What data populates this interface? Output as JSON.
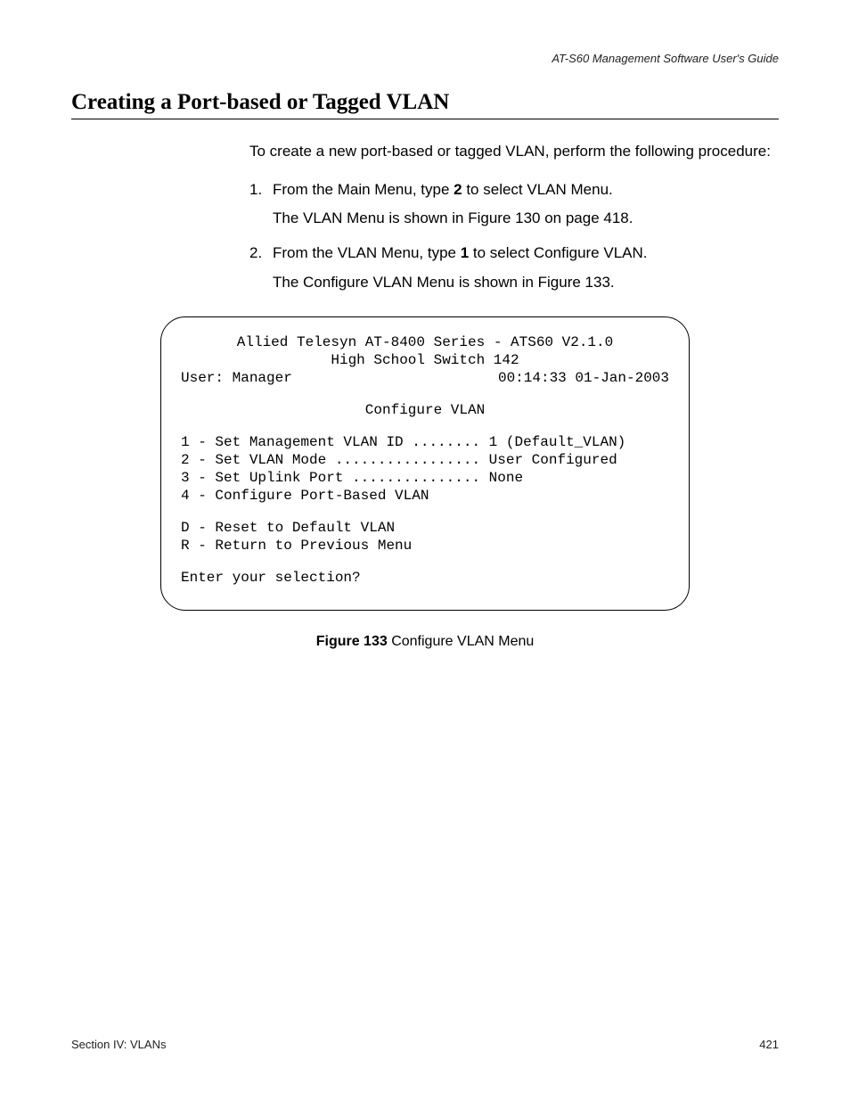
{
  "header": {
    "running_head": "AT-S60 Management Software User's Guide"
  },
  "title": "Creating a Port-based or Tagged VLAN",
  "intro": "To create a new port-based or tagged VLAN, perform the following procedure:",
  "steps": [
    {
      "num": "1.",
      "line1_a": "From the Main Menu, type ",
      "line1_bold": "2",
      "line1_b": " to select VLAN Menu.",
      "line2": "The VLAN Menu is shown in Figure 130 on page 418."
    },
    {
      "num": "2.",
      "line1_a": "From the VLAN Menu, type ",
      "line1_bold": "1",
      "line1_b": " to select Configure VLAN.",
      "line2": "The Configure VLAN Menu is shown in Figure 133."
    }
  ],
  "terminal": {
    "banner1": "Allied Telesyn AT-8400 Series - ATS60 V2.1.0",
    "banner2": "High School Switch 142",
    "user_left": "User: Manager",
    "user_right": "00:14:33 01-Jan-2003",
    "menu_title": "Configure VLAN",
    "opt1": "1 - Set Management VLAN ID ........ 1 (Default_VLAN)",
    "opt2": "2 - Set VLAN Mode ................. User Configured",
    "opt3": "3 - Set Uplink Port ............... None",
    "opt4": "4 - Configure Port-Based VLAN",
    "optD": "D - Reset to Default VLAN",
    "optR": "R - Return to Previous Menu",
    "prompt": "Enter your selection?"
  },
  "figure": {
    "label": "Figure 133",
    "caption": "  Configure VLAN Menu"
  },
  "footer": {
    "left": "Section IV: VLANs",
    "right": "421"
  }
}
